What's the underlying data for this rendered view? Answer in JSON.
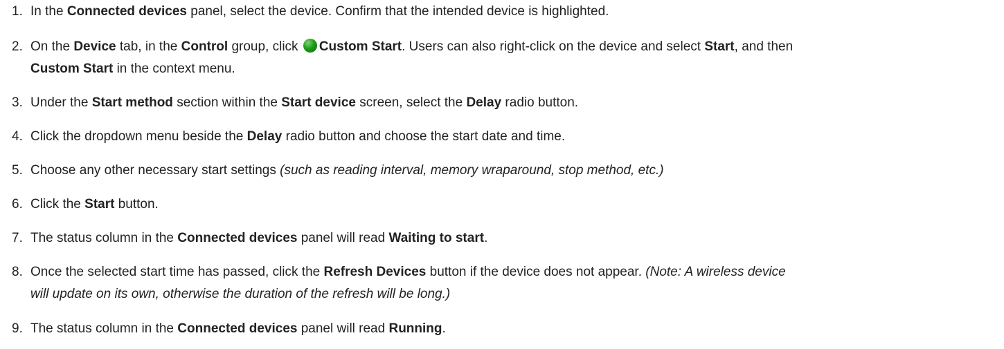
{
  "icon_color": "#1f9b1d",
  "steps": [
    {
      "num": "1.",
      "parts": [
        {
          "t": "In the "
        },
        {
          "t": "Connected devices",
          "s": "b"
        },
        {
          "t": " panel, select the device. Confirm that the intended device is highlighted."
        }
      ]
    },
    {
      "num": "2.",
      "parts": [
        {
          "t": "On the "
        },
        {
          "t": "Device",
          "s": "b"
        },
        {
          "t": " tab, in the "
        },
        {
          "t": "Control",
          "s": "b"
        },
        {
          "t": " group, click "
        },
        {
          "icon": "green-circle-icon"
        },
        {
          "t": "Custom Start",
          "s": "b"
        },
        {
          "t": ". Users can also right-click on the device and select "
        },
        {
          "t": "Start",
          "s": "b"
        },
        {
          "t": ", and then"
        },
        {
          "br": true
        },
        {
          "t": "Custom Start",
          "s": "b"
        },
        {
          "t": " in the context menu."
        }
      ]
    },
    {
      "num": "3.",
      "parts": [
        {
          "t": "Under the "
        },
        {
          "t": "Start method",
          "s": "b"
        },
        {
          "t": " section within the "
        },
        {
          "t": "Start device",
          "s": "b"
        },
        {
          "t": " screen, select the "
        },
        {
          "t": "Delay",
          "s": "b"
        },
        {
          "t": " radio button."
        }
      ]
    },
    {
      "num": "4.",
      "parts": [
        {
          "t": "Click the dropdown menu beside the "
        },
        {
          "t": "Delay",
          "s": "b"
        },
        {
          "t": " radio button and choose the start date and time."
        }
      ]
    },
    {
      "num": "5.",
      "parts": [
        {
          "t": "Choose any other necessary start settings "
        },
        {
          "t": "(such as reading interval, memory wraparound, stop method, etc.)",
          "s": "i"
        }
      ]
    },
    {
      "num": "6.",
      "parts": [
        {
          "t": "Click the "
        },
        {
          "t": "Start",
          "s": "b"
        },
        {
          "t": " button."
        }
      ]
    },
    {
      "num": "7.",
      "parts": [
        {
          "t": "The status column in the "
        },
        {
          "t": "Connected devices",
          "s": "b"
        },
        {
          "t": " panel will read "
        },
        {
          "t": "Waiting to start",
          "s": "b"
        },
        {
          "t": "."
        }
      ]
    },
    {
      "num": "8.",
      "parts": [
        {
          "t": "Once the selected start time has passed, click the "
        },
        {
          "t": "Refresh Devices",
          "s": "b"
        },
        {
          "t": " button if the device does not appear. "
        },
        {
          "t": "(Note: A wireless device",
          "s": "i"
        },
        {
          "br": true
        },
        {
          "t": "will update on its own, otherwise the duration of the refresh will be long.)",
          "s": "i"
        }
      ]
    },
    {
      "num": "9.",
      "parts": [
        {
          "t": "The status column in the "
        },
        {
          "t": "Connected devices",
          "s": "b"
        },
        {
          "t": " panel will read "
        },
        {
          "t": "Running",
          "s": "b"
        },
        {
          "t": "."
        }
      ]
    }
  ]
}
